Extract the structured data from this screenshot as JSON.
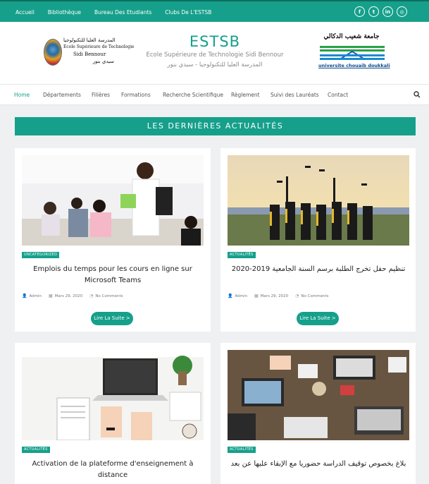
{
  "topbar": {
    "links": [
      "Accueil",
      "Bibliothèque",
      "Bureau Des Etudiants",
      "Clubs De L'ESTSB"
    ],
    "social": [
      {
        "icon": "facebook-icon",
        "glyph": "f"
      },
      {
        "icon": "twitter-icon",
        "glyph": "t"
      },
      {
        "icon": "linkedin-icon",
        "glyph": "in"
      },
      {
        "icon": "instagram-icon",
        "glyph": "◎"
      }
    ]
  },
  "header": {
    "logo_left_lines": [
      "المدرسة العليا للتكنولوجيا",
      "Ecole Supérieure de Technologie",
      "Sidi Bennour",
      "سيدي بنور"
    ],
    "title": "ESTSB",
    "subtitle": "Ecole Supérieure de Technologie Sidi Bennour",
    "subtitle_ar": "المدرسة العليا للتكنولوجيا - سيدي بنور",
    "logo_right_ar": "جامعة شعيب الدكالي",
    "logo_right_en": "universite chouaib doukkali"
  },
  "nav": {
    "items": [
      "Home",
      "Départements",
      "Filières",
      "Formations",
      "Recherche Scientifique",
      "Règlement",
      "Suivi des Lauréats",
      "Contact"
    ],
    "active": "Home"
  },
  "section_title": "LES DERNIÈRES ACTUALITÉS",
  "posts": [
    {
      "category": "UNCATEGORIZED",
      "title": "Emplois du temps pour les cours en ligne sur Microsoft Teams",
      "author": "Admin",
      "date": "Mars 29, 2020",
      "comments": "No Comments",
      "button": "Lire La Suite >"
    },
    {
      "category": "ACTUALITÉS",
      "title": "تنظيم حفل تخرج الطلبة برسم السنة الجامعية 2019-2020",
      "author": "Admin",
      "date": "Mars 29, 2020",
      "comments": "No Comments",
      "button": "Lire La Suite >"
    },
    {
      "category": "ACTUALITÉS",
      "title": "Activation de la plateforme d'enseignement à distance"
    },
    {
      "category": "ACTUALITÉS",
      "title": "بلاغ بخصوص توقيف الدراسة حضوريا مع الإبقاء عليها عن بعد"
    }
  ],
  "colors": {
    "accent": "#16a08b",
    "accent_dark": "#0c6f60",
    "background": "#eef0f1"
  }
}
